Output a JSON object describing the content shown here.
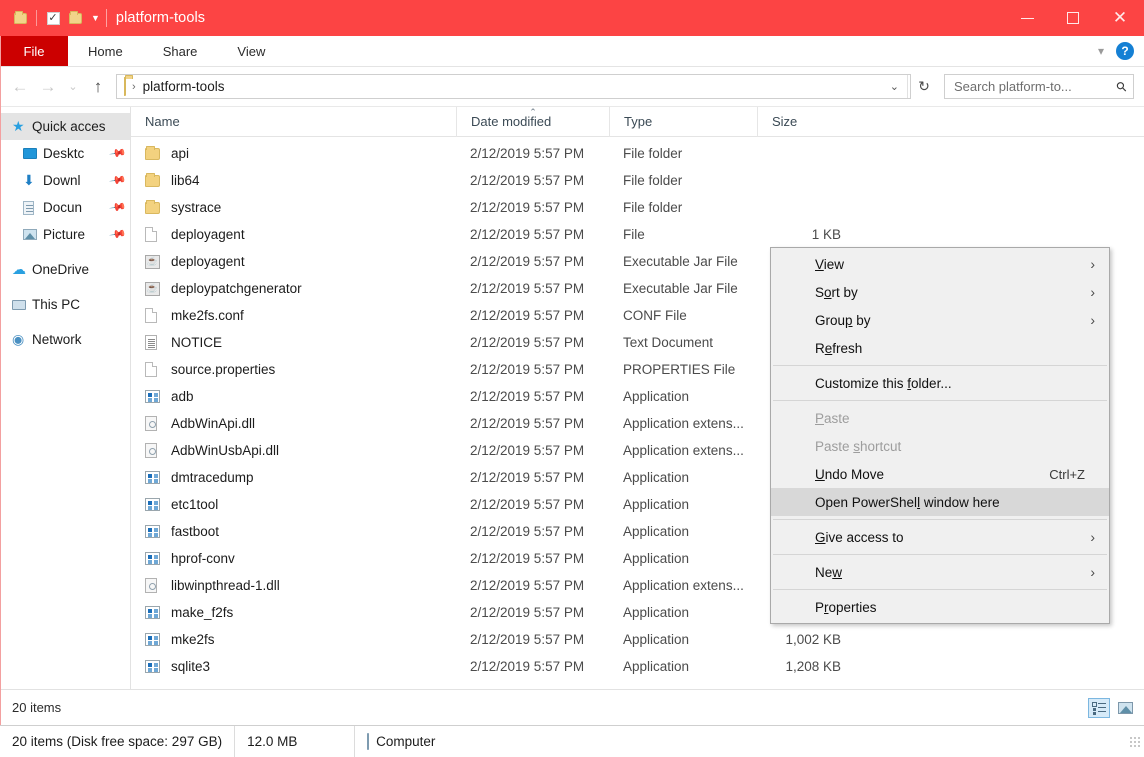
{
  "window": {
    "title": "platform-tools",
    "accent_color": "#fc4444",
    "file_tab_color": "#cc0000",
    "quick_access_toolbar": [
      {
        "name": "explorer-icon",
        "label": "Explorer"
      },
      {
        "name": "properties-icon",
        "label": "Properties"
      },
      {
        "name": "new-folder-icon",
        "label": "New folder"
      },
      {
        "name": "customize-qat-caret",
        "label": "Customize Quick Access Toolbar"
      }
    ],
    "controls": {
      "minimize": "Minimize",
      "maximize": "Restore Down",
      "close": "Close"
    }
  },
  "ribbon": {
    "tabs": [
      {
        "label": "File",
        "active": true
      },
      {
        "label": "Home",
        "active": false
      },
      {
        "label": "Share",
        "active": false
      },
      {
        "label": "View",
        "active": false
      }
    ],
    "collapse_label": "Minimize the Ribbon",
    "help_label": "?"
  },
  "address": {
    "back_glyph": "←",
    "forward_glyph": "→",
    "recent_glyph": "⌄",
    "up_glyph": "↑",
    "breadcrumb_separator": "›",
    "path": "platform-tools",
    "dropdown_glyph": "⌄",
    "refresh_glyph": "↻"
  },
  "search": {
    "placeholder": "Search platform-to...",
    "icon": "search-icon"
  },
  "sidebar": {
    "items": [
      {
        "label": "Quick acces",
        "icon": "star-icon",
        "selected": true,
        "pinned": false,
        "indent": false
      },
      {
        "label": "Desktc",
        "icon": "desktop-icon",
        "selected": false,
        "pinned": true,
        "indent": true
      },
      {
        "label": "Downl",
        "icon": "download-icon",
        "selected": false,
        "pinned": true,
        "indent": true
      },
      {
        "label": "Docun",
        "icon": "documents-icon",
        "selected": false,
        "pinned": true,
        "indent": true
      },
      {
        "label": "Picture",
        "icon": "pictures-icon",
        "selected": false,
        "pinned": true,
        "indent": true
      },
      {
        "label": "OneDrive",
        "icon": "cloud-icon",
        "selected": false,
        "pinned": false,
        "indent": false
      },
      {
        "label": "This PC",
        "icon": "pc-icon",
        "selected": false,
        "pinned": false,
        "indent": false
      },
      {
        "label": "Network",
        "icon": "network-icon",
        "selected": false,
        "pinned": false,
        "indent": false
      }
    ],
    "pin_glyph": "📌"
  },
  "columns": {
    "name": "Name",
    "date_modified": "Date modified",
    "type": "Type",
    "size": "Size",
    "sorted_by": "Date modified",
    "sort_direction": "ascending",
    "sort_caret": "⌃"
  },
  "files": [
    {
      "name": "api",
      "icon": "folder-icon",
      "date": "2/12/2019 5:57 PM",
      "type": "File folder",
      "size": ""
    },
    {
      "name": "lib64",
      "icon": "folder-icon",
      "date": "2/12/2019 5:57 PM",
      "type": "File folder",
      "size": ""
    },
    {
      "name": "systrace",
      "icon": "folder-icon",
      "date": "2/12/2019 5:57 PM",
      "type": "File folder",
      "size": ""
    },
    {
      "name": "deployagent",
      "icon": "file-icon",
      "date": "2/12/2019 5:57 PM",
      "type": "File",
      "size": "1 KB"
    },
    {
      "name": "deployagent",
      "icon": "jar-icon",
      "date": "2/12/2019 5:57 PM",
      "type": "Executable Jar File",
      "size": ""
    },
    {
      "name": "deploypatchgenerator",
      "icon": "jar-icon",
      "date": "2/12/2019 5:57 PM",
      "type": "Executable Jar File",
      "size": ""
    },
    {
      "name": "mke2fs.conf",
      "icon": "file-icon",
      "date": "2/12/2019 5:57 PM",
      "type": "CONF File",
      "size": ""
    },
    {
      "name": "NOTICE",
      "icon": "text-icon",
      "date": "2/12/2019 5:57 PM",
      "type": "Text Document",
      "size": ""
    },
    {
      "name": "source.properties",
      "icon": "file-icon",
      "date": "2/12/2019 5:57 PM",
      "type": "PROPERTIES File",
      "size": ""
    },
    {
      "name": "adb",
      "icon": "exe-icon",
      "date": "2/12/2019 5:57 PM",
      "type": "Application",
      "size": ""
    },
    {
      "name": "AdbWinApi.dll",
      "icon": "dll-icon",
      "date": "2/12/2019 5:57 PM",
      "type": "Application extens...",
      "size": ""
    },
    {
      "name": "AdbWinUsbApi.dll",
      "icon": "dll-icon",
      "date": "2/12/2019 5:57 PM",
      "type": "Application extens...",
      "size": ""
    },
    {
      "name": "dmtracedump",
      "icon": "exe-icon",
      "date": "2/12/2019 5:57 PM",
      "type": "Application",
      "size": ""
    },
    {
      "name": "etc1tool",
      "icon": "exe-icon",
      "date": "2/12/2019 5:57 PM",
      "type": "Application",
      "size": ""
    },
    {
      "name": "fastboot",
      "icon": "exe-icon",
      "date": "2/12/2019 5:57 PM",
      "type": "Application",
      "size": ""
    },
    {
      "name": "hprof-conv",
      "icon": "exe-icon",
      "date": "2/12/2019 5:57 PM",
      "type": "Application",
      "size": ""
    },
    {
      "name": "libwinpthread-1.dll",
      "icon": "dll-icon",
      "date": "2/12/2019 5:57 PM",
      "type": "Application extens...",
      "size": ""
    },
    {
      "name": "make_f2fs",
      "icon": "exe-icon",
      "date": "2/12/2019 5:57 PM",
      "type": "Application",
      "size": ""
    },
    {
      "name": "mke2fs",
      "icon": "exe-icon",
      "date": "2/12/2019 5:57 PM",
      "type": "Application",
      "size": "1,002 KB"
    },
    {
      "name": "sqlite3",
      "icon": "exe-icon",
      "date": "2/12/2019 5:57 PM",
      "type": "Application",
      "size": "1,208 KB"
    }
  ],
  "context_menu": {
    "items": [
      {
        "label": "View",
        "mnemonic_index": 0,
        "submenu": true,
        "disabled": false,
        "highlighted": false,
        "accel": "",
        "separator_after": false
      },
      {
        "label": "Sort by",
        "mnemonic_index": 1,
        "submenu": true,
        "disabled": false,
        "highlighted": false,
        "accel": "",
        "separator_after": false
      },
      {
        "label": "Group by",
        "mnemonic_index": 4,
        "submenu": true,
        "disabled": false,
        "highlighted": false,
        "accel": "",
        "separator_after": false
      },
      {
        "label": "Refresh",
        "mnemonic_index": 1,
        "submenu": false,
        "disabled": false,
        "highlighted": false,
        "accel": "",
        "separator_after": true
      },
      {
        "label": "Customize this folder...",
        "mnemonic_index": 15,
        "submenu": false,
        "disabled": false,
        "highlighted": false,
        "accel": "",
        "separator_after": true
      },
      {
        "label": "Paste",
        "mnemonic_index": 0,
        "submenu": false,
        "disabled": true,
        "highlighted": false,
        "accel": "",
        "separator_after": false
      },
      {
        "label": "Paste shortcut",
        "mnemonic_index": 6,
        "submenu": false,
        "disabled": true,
        "highlighted": false,
        "accel": "",
        "separator_after": false
      },
      {
        "label": "Undo Move",
        "mnemonic_index": 0,
        "submenu": false,
        "disabled": false,
        "highlighted": false,
        "accel": "Ctrl+Z",
        "separator_after": false
      },
      {
        "label": "Open PowerShell window here",
        "mnemonic_index": 14,
        "submenu": false,
        "disabled": false,
        "highlighted": true,
        "accel": "",
        "separator_after": true
      },
      {
        "label": "Give access to",
        "mnemonic_index": 0,
        "submenu": true,
        "disabled": false,
        "highlighted": false,
        "accel": "",
        "separator_after": true
      },
      {
        "label": "New",
        "mnemonic_index": 2,
        "submenu": true,
        "disabled": false,
        "highlighted": false,
        "accel": "",
        "separator_after": true
      },
      {
        "label": "Properties",
        "mnemonic_index": 1,
        "submenu": false,
        "disabled": false,
        "highlighted": false,
        "accel": "",
        "separator_after": false
      }
    ],
    "submenu_arrow": "›"
  },
  "status_bar": {
    "item_count": "20 items",
    "view_details_label": "Details view",
    "view_tiles_label": "Large icons view"
  },
  "taskbar": {
    "items_text": "20 items (Disk free space: 297 GB)",
    "total_size": "12.0 MB",
    "location": "Computer",
    "location_icon": "computer-icon"
  }
}
